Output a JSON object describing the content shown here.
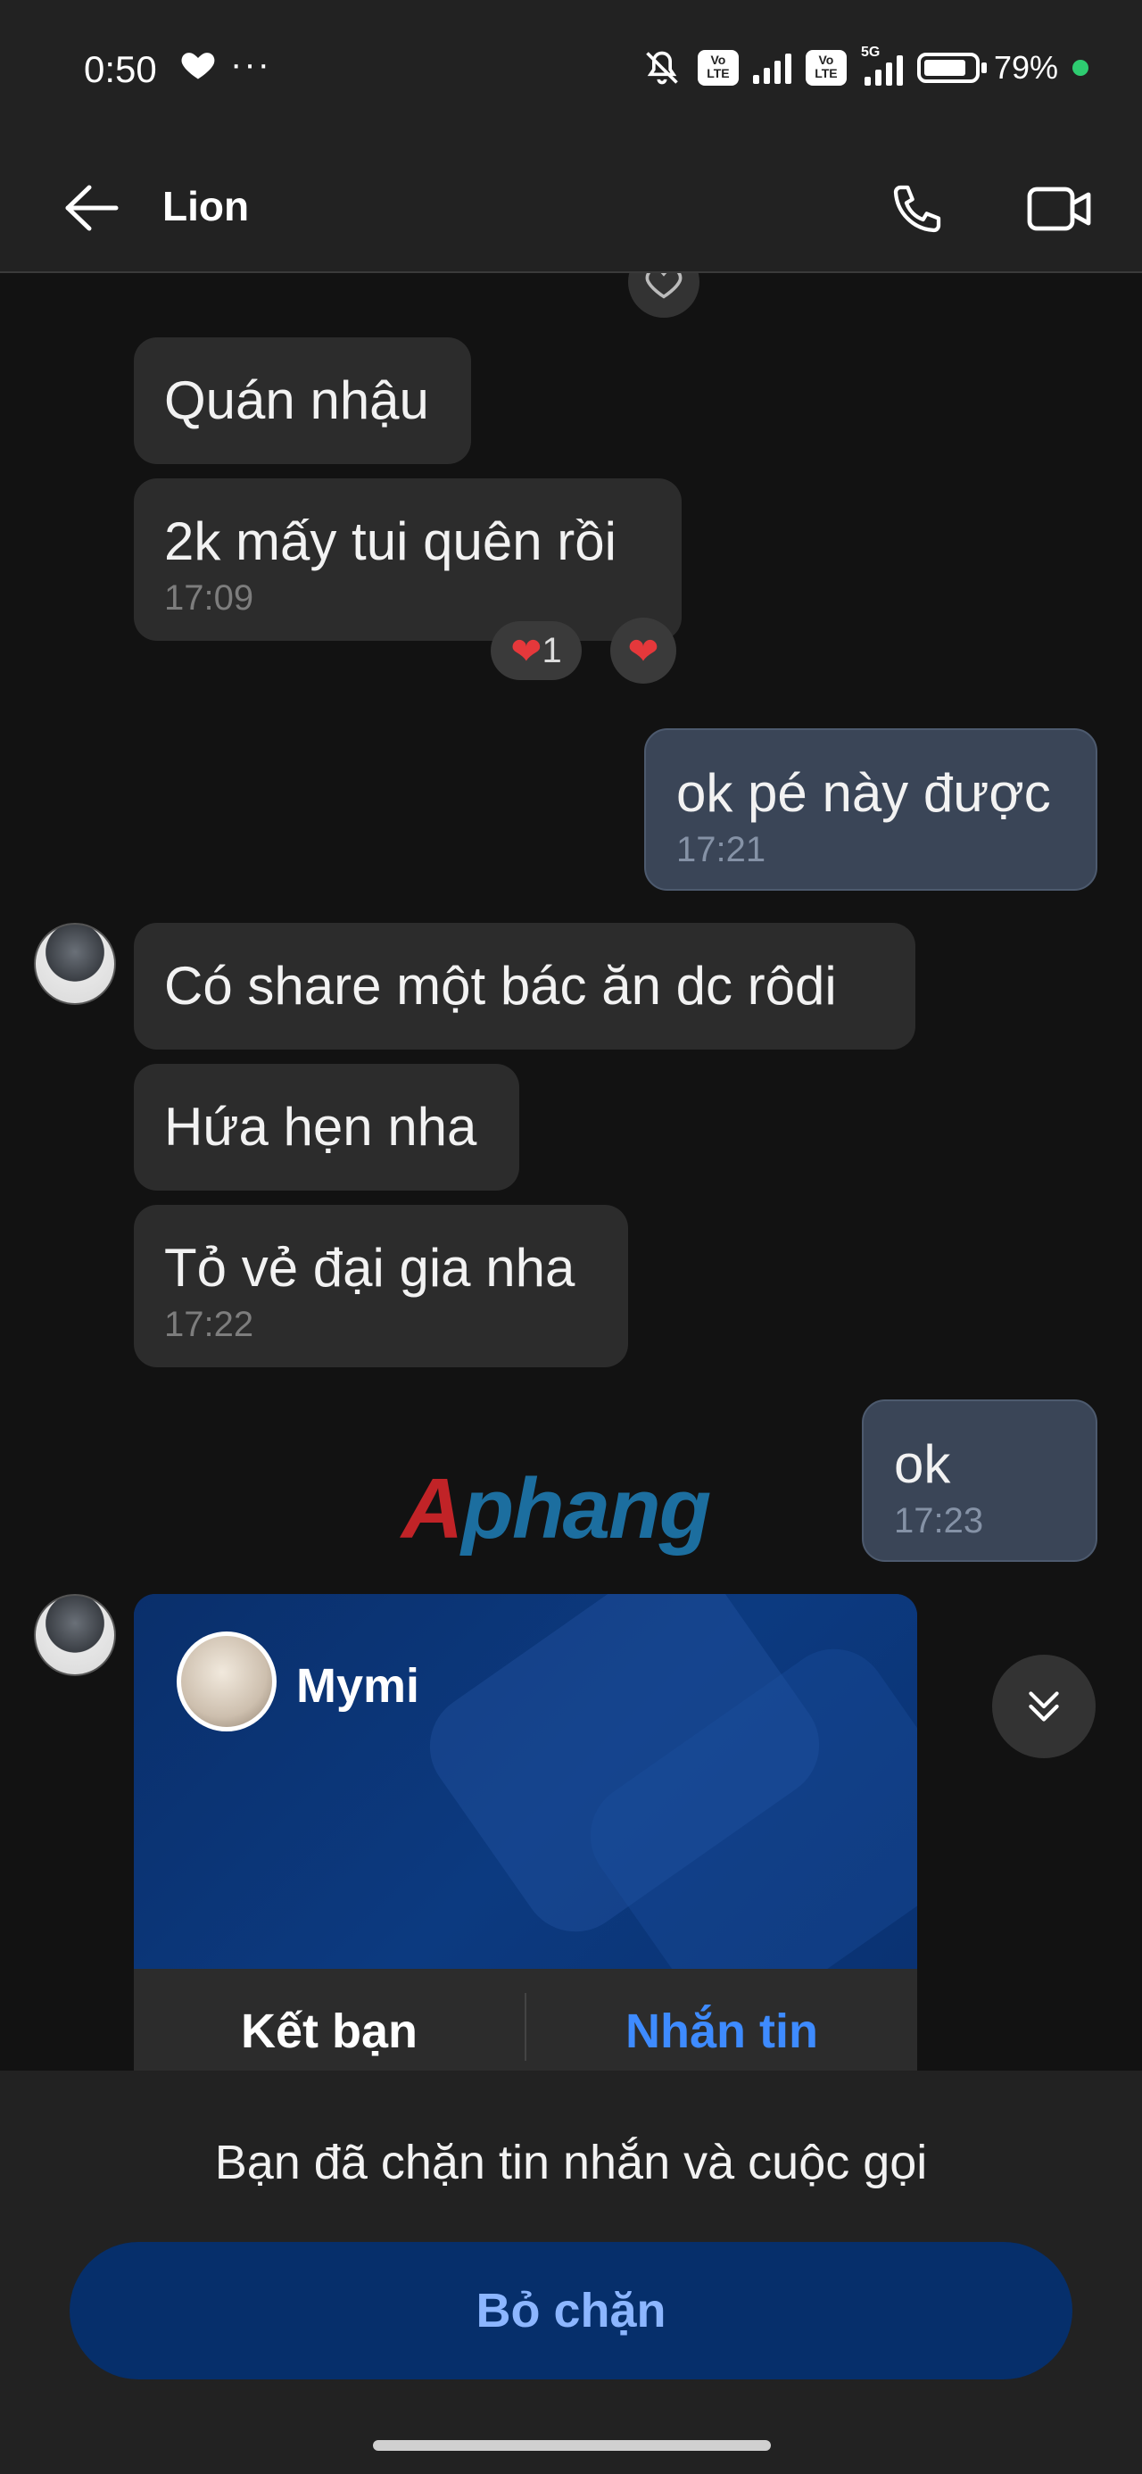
{
  "status_bar": {
    "time": "0:50",
    "dots": "···",
    "battery_percent": "79%",
    "volte_label_1": "Vo\nLTE",
    "volte_label_2": "Vo\nLTE",
    "network_label": "5G"
  },
  "header": {
    "contact_name": "Lion"
  },
  "messages": [
    {
      "text": "Quán nhậu",
      "time": "",
      "direction": "in"
    },
    {
      "text": "2k mấy tui quên rồi",
      "time": "17:09",
      "direction": "in"
    },
    {
      "text": "ok pé này được",
      "time": "17:21",
      "direction": "out"
    },
    {
      "text": "Có share một bác ăn dc rôdi",
      "time": "",
      "direction": "in"
    },
    {
      "text": "Hứa hẹn nha",
      "time": "",
      "direction": "in"
    },
    {
      "text": "Tỏ vẻ đại gia nha",
      "time": "17:22",
      "direction": "in"
    },
    {
      "text": "ok",
      "time": "17:23",
      "direction": "out"
    }
  ],
  "reactions": {
    "heart_count": "1"
  },
  "contact_card": {
    "name": "Mymi",
    "add_friend_label": "Kết bạn",
    "message_label": "Nhắn tin"
  },
  "watermark": {
    "part1": "A",
    "part2": "phang"
  },
  "footer": {
    "blocked_text": "Bạn đã chặn tin nhắn và cuộc gọi",
    "unblock_label": "Bỏ chặn"
  },
  "colors": {
    "accent_blue": "#3e8bff",
    "card_blue": "#0a3270",
    "unblock_bg": "#062f6b",
    "heart_red": "#e5383b"
  }
}
